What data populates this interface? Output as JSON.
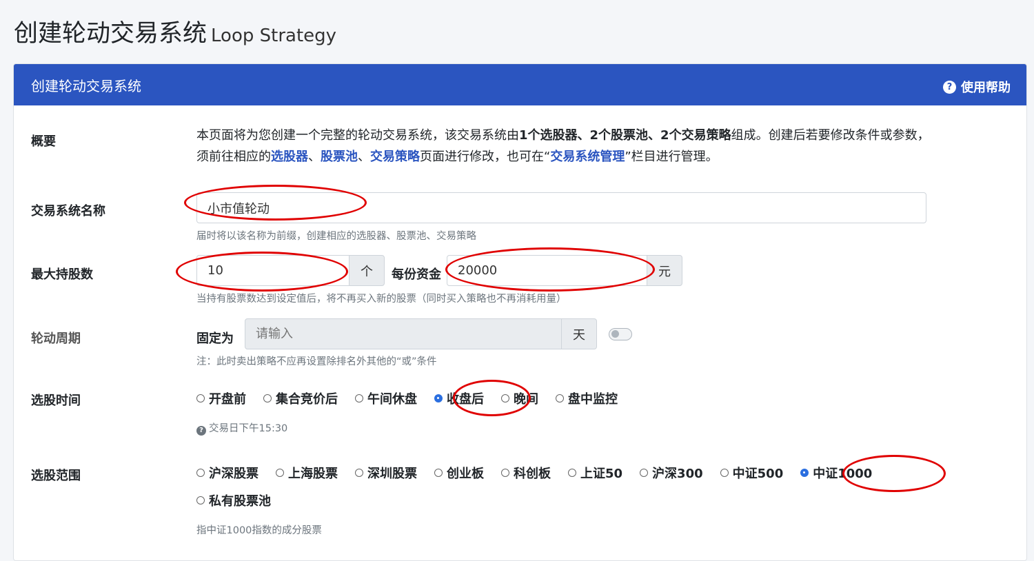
{
  "page": {
    "title": "创建轮动交易系统",
    "subtitle": "Loop Strategy"
  },
  "card": {
    "title": "创建轮动交易系统",
    "help_label": "使用帮助"
  },
  "overview": {
    "label": "概要",
    "t1": "本页面将为您创建一个完整的轮动交易系统，该交易系统由",
    "b1": "1个选股器、2个股票池、2个交易策略",
    "t2": "组成。创建后若要修改条件或参数，须前往相应的",
    "link_selector": "选股器",
    "sep1": "、",
    "link_pool": "股票池",
    "sep2": "、",
    "link_strategy": "交易策略",
    "t3": "页面进行修改，也可在“",
    "link_manage": "交易系统管理",
    "t4": "”栏目进行管理。"
  },
  "name_field": {
    "label": "交易系统名称",
    "value": "小市值轮动",
    "hint": "届时将以该名称为前缀，创建相应的选股器、股票池、交易策略"
  },
  "max_hold": {
    "label": "最大持股数",
    "value": "10",
    "unit": "个",
    "fund_label": "每份资金",
    "fund_value": "20000",
    "fund_unit": "元",
    "hint": "当持有股票数达到设定值后，将不再买入新的股票（同时买入策略也不再消耗用量）"
  },
  "cycle": {
    "label": "轮动周期",
    "prefix": "固定为",
    "placeholder": "请输入",
    "unit": "天",
    "enabled": false,
    "hint": "注：此时卖出策略不应再设置除排名外其他的“或”条件"
  },
  "pick_time": {
    "label": "选股时间",
    "options": [
      "开盘前",
      "集合竞价后",
      "午间休盘",
      "收盘后",
      "晚间",
      "盘中监控"
    ],
    "selected": "收盘后",
    "hint": "交易日下午15:30"
  },
  "pick_range": {
    "label": "选股范围",
    "options": [
      "沪深股票",
      "上海股票",
      "深圳股票",
      "创业板",
      "科创板",
      "上证50",
      "沪深300",
      "中证500",
      "中证1000",
      "私有股票池"
    ],
    "selected": "中证1000",
    "hint": "指中证1000指数的成分股票"
  },
  "colors": {
    "header": "#2b55c0",
    "link": "#2b55c0",
    "annotation": "#e00000"
  }
}
